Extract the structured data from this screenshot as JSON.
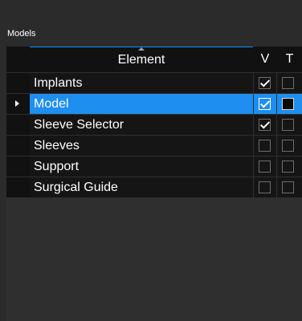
{
  "panel": {
    "title": "Models"
  },
  "columns": {
    "element": "Element",
    "v": "V",
    "t": "T"
  },
  "rows": [
    {
      "name": "Implants",
      "v": true,
      "t": false,
      "selected": false
    },
    {
      "name": "Model",
      "v": true,
      "t": false,
      "selected": true
    },
    {
      "name": "Sleeve Selector",
      "v": true,
      "t": false,
      "selected": false
    },
    {
      "name": "Sleeves",
      "v": false,
      "t": false,
      "selected": false
    },
    {
      "name": "Support",
      "v": false,
      "t": false,
      "selected": false
    },
    {
      "name": "Surgical Guide",
      "v": false,
      "t": false,
      "selected": false
    }
  ],
  "colors": {
    "selection": "#1e8ef0",
    "sort_indicator": "#0e8fff"
  }
}
